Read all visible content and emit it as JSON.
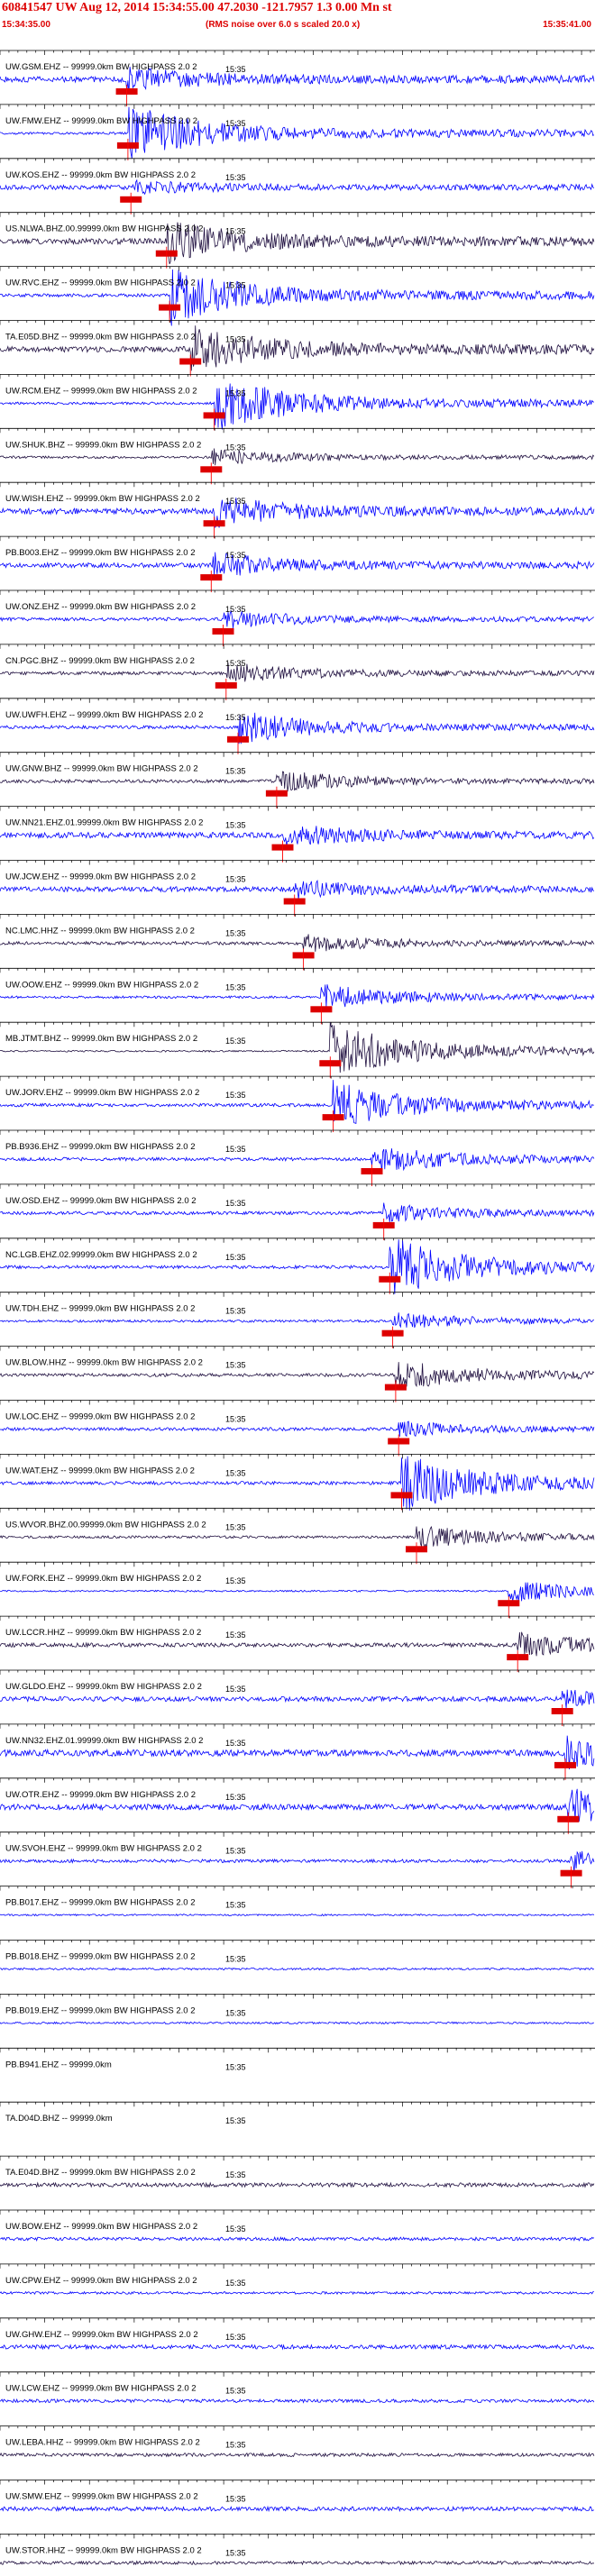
{
  "header": {
    "title": "60841547 UW Aug 12, 2014 15:34:55.00   47.2030 -121.7957  1.3 0.00 Mn st",
    "start_time": "15:34:35.00",
    "noise_note": "(RMS noise over 6.0 s scaled 20.0 x)",
    "end_time": "15:35:41.00"
  },
  "colors": {
    "header_text": "#dd0000",
    "blue_trace": "#0000ff",
    "dark_trace": "#201040",
    "pick_marker": "#dd0000",
    "pick_line": "#ff0000",
    "axis": "#000000"
  },
  "chart_data": {
    "type": "line",
    "title": "60841547 UW Aug 12, 2014 15:34:55.00   47.2030 -121.7957  1.3 0.00 Mn st",
    "time_range": [
      "15:34:35.00",
      "15:35:41.00"
    ],
    "tick_label": "15:35",
    "series": [
      {
        "name": "UW.GSM.EHZ -- 99999.0km BW  HIGHPASS  2.0  2",
        "color": "blue",
        "pick": 0.213,
        "amp": 0.35,
        "burst": 0.4
      },
      {
        "name": "UW.FMW.EHZ -- 99999.0km BW  HIGHPASS  2.0  2",
        "color": "blue",
        "pick": 0.215,
        "amp": 0.15,
        "burst": 1.0
      },
      {
        "name": "UW.KOS.EHZ -- 99999.0km BW  HIGHPASS  2.0  2",
        "color": "blue",
        "pick": 0.22,
        "amp": 0.3,
        "burst": 0.2
      },
      {
        "name": "US.NLWA.BHZ.00.99999.0km BW  HIGHPASS  2.0  2",
        "color": "dark",
        "pick": 0.28,
        "amp": 0.35,
        "burst": 0.7
      },
      {
        "name": "UW.RVC.EHZ -- 99999.0km BW  HIGHPASS  2.0  2",
        "color": "blue",
        "pick": 0.285,
        "amp": 0.2,
        "burst": 1.0
      },
      {
        "name": "TA.E05D.BHZ -- 99999.0km BW  HIGHPASS  2.0  2",
        "color": "dark",
        "pick": 0.32,
        "amp": 0.35,
        "burst": 0.8
      },
      {
        "name": "UW.RCM.EHZ -- 99999.0km BW  HIGHPASS  2.0  2",
        "color": "blue",
        "pick": 0.36,
        "amp": 0.15,
        "burst": 1.0
      },
      {
        "name": "UW.SHUK.BHZ -- 99999.0km BW  HIGHPASS  2.0  2",
        "color": "dark",
        "pick": 0.355,
        "amp": 0.15,
        "burst": 0.3
      },
      {
        "name": "UW.WISH.EHZ -- 99999.0km BW  HIGHPASS  2.0  2",
        "color": "blue",
        "pick": 0.36,
        "amp": 0.35,
        "burst": 0.5
      },
      {
        "name": "PB.B003.EHZ -- 99999.0km BW  HIGHPASS  2.0  2",
        "color": "blue",
        "pick": 0.355,
        "amp": 0.3,
        "burst": 0.4
      },
      {
        "name": "UW.ONZ.EHZ -- 99999.0km BW  HIGHPASS  2.0  2",
        "color": "blue",
        "pick": 0.375,
        "amp": 0.2,
        "burst": 0.3
      },
      {
        "name": "CN.PGC.BHZ -- 99999.0km BW  HIGHPASS  2.0  2",
        "color": "dark",
        "pick": 0.38,
        "amp": 0.2,
        "burst": 0.35
      },
      {
        "name": "UW.UWFH.EHZ -- 99999.0km BW  HIGHPASS  2.0  2",
        "color": "blue",
        "pick": 0.4,
        "amp": 0.2,
        "burst": 0.55
      },
      {
        "name": "UW.GNW.BHZ -- 99999.0km BW  HIGHPASS  2.0  2",
        "color": "dark",
        "pick": 0.465,
        "amp": 0.2,
        "burst": 0.35
      },
      {
        "name": "UW.NN21.EHZ.01.99999.0km BW  HIGHPASS  2.0  2",
        "color": "blue",
        "pick": 0.475,
        "amp": 0.35,
        "burst": 0.35
      },
      {
        "name": "UW.JCW.EHZ -- 99999.0km BW  HIGHPASS  2.0  2",
        "color": "blue",
        "pick": 0.495,
        "amp": 0.3,
        "burst": 0.3
      },
      {
        "name": "NC.LMC.HHZ -- 99999.0km BW  HIGHPASS  2.0  2",
        "color": "dark",
        "pick": 0.51,
        "amp": 0.2,
        "burst": 0.3
      },
      {
        "name": "UW.OOW.EHZ -- 99999.0km BW  HIGHPASS  2.0  2",
        "color": "blue",
        "pick": 0.54,
        "amp": 0.15,
        "burst": 0.45
      },
      {
        "name": "MB.JTMT.BHZ -- 99999.0km BW  HIGHPASS  2.0  2",
        "color": "dark",
        "pick": 0.555,
        "amp": 0.1,
        "burst": 1.0
      },
      {
        "name": "UW.JORV.EHZ -- 99999.0km BW  HIGHPASS  2.0  2",
        "color": "blue",
        "pick": 0.56,
        "amp": 0.2,
        "burst": 0.8
      },
      {
        "name": "PB.B936.EHZ -- 99999.0km BW  HIGHPASS  2.0  2",
        "color": "blue",
        "pick": 0.625,
        "amp": 0.2,
        "burst": 0.5
      },
      {
        "name": "UW.OSD.EHZ -- 99999.0km BW  HIGHPASS  2.0  2",
        "color": "blue",
        "pick": 0.645,
        "amp": 0.2,
        "burst": 0.3
      },
      {
        "name": "NC.LGB.EHZ.02.99999.0km BW  HIGHPASS  2.0  2",
        "color": "blue",
        "pick": 0.655,
        "amp": 0.2,
        "burst": 1.0
      },
      {
        "name": "UW.TDH.EHZ -- 99999.0km BW  HIGHPASS  2.0  2",
        "color": "blue",
        "pick": 0.66,
        "amp": 0.15,
        "burst": 0.3
      },
      {
        "name": "UW.BLOW.HHZ -- 99999.0km BW  HIGHPASS  2.0  2",
        "color": "dark",
        "pick": 0.665,
        "amp": 0.2,
        "burst": 0.5
      },
      {
        "name": "UW.LOC.EHZ -- 99999.0km BW  HIGHPASS  2.0  2",
        "color": "blue",
        "pick": 0.67,
        "amp": 0.2,
        "burst": 0.25
      },
      {
        "name": "UW.WAT.EHZ -- 99999.0km BW  HIGHPASS  2.0  2",
        "color": "blue",
        "pick": 0.675,
        "amp": 0.2,
        "burst": 1.0
      },
      {
        "name": "US.WVOR.BHZ.00.99999.0km BW  HIGHPASS  2.0  2",
        "color": "dark",
        "pick": 0.7,
        "amp": 0.15,
        "burst": 0.4
      },
      {
        "name": "UW.FORK.EHZ -- 99999.0km BW  HIGHPASS  2.0  2",
        "color": "blue",
        "pick": 0.855,
        "amp": 0.1,
        "burst": 0.4
      },
      {
        "name": "UW.LCCR.HHZ -- 99999.0km BW  HIGHPASS  2.0  2",
        "color": "dark",
        "pick": 0.87,
        "amp": 0.25,
        "burst": 0.4
      },
      {
        "name": "UW.GLDO.EHZ -- 99999.0km BW  HIGHPASS  2.0  2",
        "color": "blue",
        "pick": 0.945,
        "amp": 0.3,
        "burst": 0.3
      },
      {
        "name": "UW.NN32.EHZ.01.99999.0km BW  HIGHPASS  2.0  2",
        "color": "blue",
        "pick": 0.95,
        "amp": 0.4,
        "burst": 0.5
      },
      {
        "name": "UW.OTR.EHZ -- 99999.0km BW  HIGHPASS  2.0  2",
        "color": "blue",
        "pick": 0.955,
        "amp": 0.35,
        "burst": 0.6
      },
      {
        "name": "UW.SVOH.EHZ -- 99999.0km BW  HIGHPASS  2.0  2",
        "color": "blue",
        "pick": 0.96,
        "amp": 0.2,
        "burst": 0.35
      },
      {
        "name": "PB.B017.EHZ -- 99999.0km BW  HIGHPASS  2.0  2",
        "color": "blue",
        "pick": null,
        "amp": 0.1,
        "burst": 0.1
      },
      {
        "name": "PB.B018.EHZ -- 99999.0km BW  HIGHPASS  2.0  2",
        "color": "blue",
        "pick": null,
        "amp": 0.12,
        "burst": 0.2
      },
      {
        "name": "PB.B019.EHZ -- 99999.0km BW  HIGHPASS  2.0  2",
        "color": "blue",
        "pick": null,
        "amp": 0.12,
        "burst": 0.15
      },
      {
        "name": "PB.B941.EHZ -- 99999.0km",
        "color": "blue",
        "pick": null,
        "amp": 0.0,
        "burst": 0.0
      },
      {
        "name": "TA.D04D.BHZ -- 99999.0km",
        "color": "blue",
        "pick": null,
        "amp": 0.0,
        "burst": 0.0
      },
      {
        "name": "TA.E04D.BHZ -- 99999.0km BW  HIGHPASS  2.0  2",
        "color": "dark",
        "pick": null,
        "amp": 0.25,
        "burst": 0.0
      },
      {
        "name": "UW.BOW.EHZ -- 99999.0km BW  HIGHPASS  2.0  2",
        "color": "blue",
        "pick": null,
        "amp": 0.2,
        "burst": 0.0
      },
      {
        "name": "UW.CPW.EHZ -- 99999.0km BW  HIGHPASS  2.0  2",
        "color": "blue",
        "pick": null,
        "amp": 0.15,
        "burst": 0.2
      },
      {
        "name": "UW.GHW.EHZ -- 99999.0km BW  HIGHPASS  2.0  2",
        "color": "blue",
        "pick": null,
        "amp": 0.25,
        "burst": 0.0
      },
      {
        "name": "UW.LCW.EHZ -- 99999.0km BW  HIGHPASS  2.0  2",
        "color": "blue",
        "pick": null,
        "amp": 0.2,
        "burst": 0.0
      },
      {
        "name": "UW.LEBA.HHZ -- 99999.0km BW  HIGHPASS  2.0  2",
        "color": "dark",
        "pick": null,
        "amp": 0.2,
        "burst": 0.0
      },
      {
        "name": "UW.SMW.EHZ -- 99999.0km BW  HIGHPASS  2.0  2",
        "color": "blue",
        "pick": null,
        "amp": 0.25,
        "burst": 0.0
      },
      {
        "name": "UW.STOR.HHZ -- 99999.0km BW  HIGHPASS  2.0  2",
        "color": "dark",
        "pick": null,
        "amp": 0.2,
        "burst": 0.0
      }
    ]
  }
}
